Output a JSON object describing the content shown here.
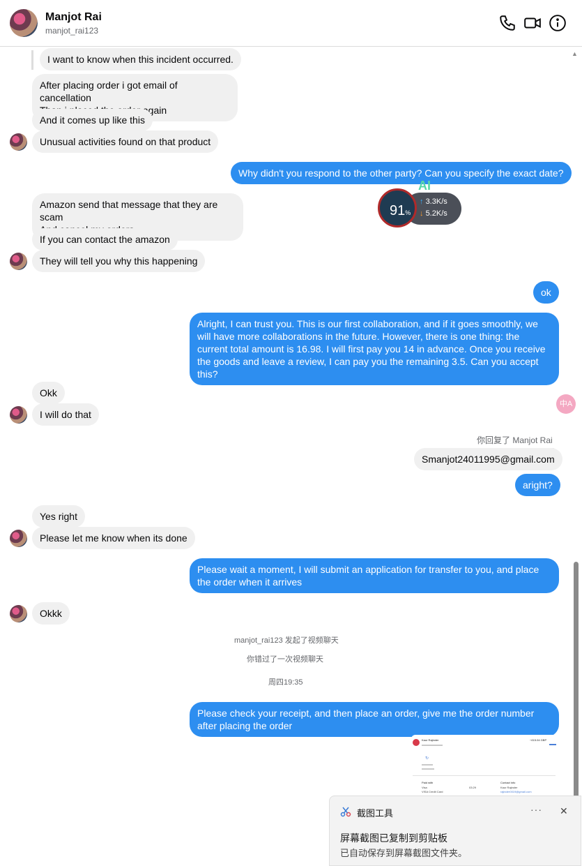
{
  "header": {
    "name": "Manjot Rai",
    "username": "manjot_rai123"
  },
  "messages": [
    {
      "text": "I want to know when this incident occurred."
    },
    {
      "text": "After placing order i got email of cancellation\nThan i placed the order again"
    },
    {
      "text": "And it comes up like this"
    },
    {
      "text": "Unusual activities found on that product"
    },
    {
      "text": "Why didn't you respond to the other party? Can you specify the exact date?"
    },
    {
      "text": "Amazon send that message that they are scam\nAnd cancel my orders"
    },
    {
      "text": "If you can contact the amazon"
    },
    {
      "text": "They will tell you why this happening"
    },
    {
      "text": "ok"
    },
    {
      "text": "Alright, I can trust you. This is our first collaboration, and if it goes smoothly, we will have more collaborations in the future. However, there is one thing: the current total amount is 16.98. I will first pay you 14 in advance. Once you receive the goods and leave a review, I can pay you the remaining 3.5. Can you accept this?"
    },
    {
      "text": "Okk"
    },
    {
      "text": "I will do that"
    },
    {
      "text": "Smanjot24011995@gmail.com"
    },
    {
      "text": "aright?"
    },
    {
      "text": "Yes right"
    },
    {
      "text": "Please let me know when its done"
    },
    {
      "text": "Please wait a moment, I will submit an application for transfer to you, and place the order when it arrives"
    },
    {
      "text": "Okkk"
    },
    {
      "text": "Please check your receipt, and then place an order, give me the order number after placing the order"
    }
  ],
  "reply_note": "你回复了 Manjot Rai",
  "system": {
    "video_started": "manjot_rai123 发起了视频聊天",
    "missed_call": "你错过了一次视频聊天",
    "timestamp": "周四19:35"
  },
  "net_monitor": {
    "percent": "91",
    "percent_sign": "%",
    "ai_label": "AI",
    "upload": "3.3",
    "download": "5.2",
    "unit": "K/s"
  },
  "translate_label": "中A",
  "receipt": {
    "name": "Kaur Rajinder",
    "amount": "−£15.04 GBP",
    "paid_with": "Paid with",
    "method": "Visa",
    "card": "VISA Credit Card",
    "time": "03:29",
    "contact": "Contact info",
    "contact_name": "Kaur Rajinder",
    "email": "rajinder0019@gmail.com"
  },
  "toast": {
    "app": "截图工具",
    "more": "···",
    "close": "✕",
    "title": "屏幕截图已复制到剪贴板",
    "body": "已自动保存到屏幕截图文件夹。"
  }
}
